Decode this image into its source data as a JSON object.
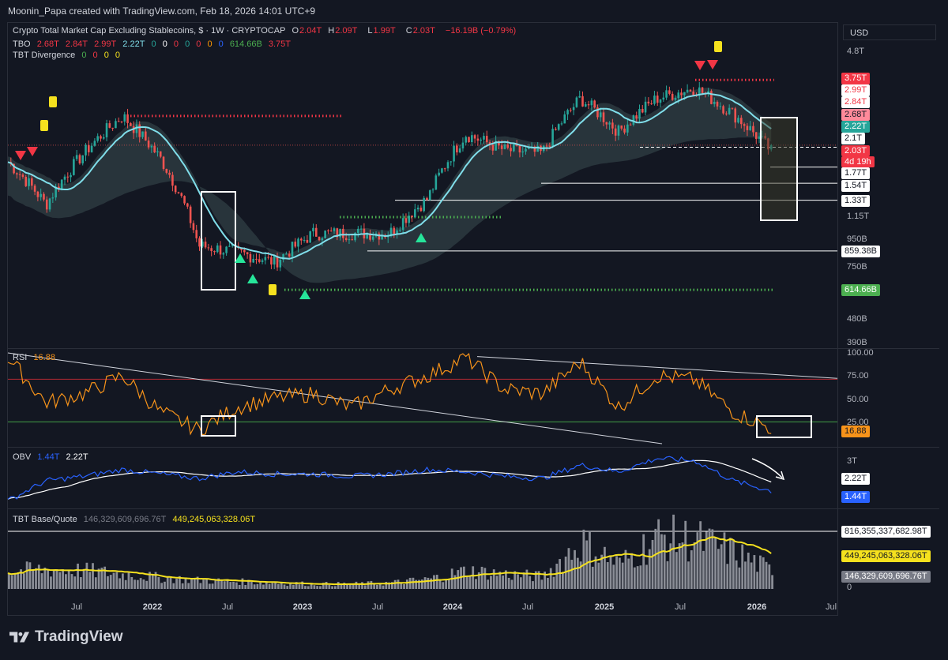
{
  "header": {
    "attribution": "Moonin_Papa created with TradingView.com, Feb 18, 2026 14:01 UTC+9"
  },
  "price_legend": {
    "symbol": "Crypto Total Market Cap Excluding Stablecoins, $ · 1W · CRYPTOCAP",
    "o_label": "O",
    "o": "2.04T",
    "h_label": "H",
    "h": "2.09T",
    "l_label": "L",
    "l": "1.99T",
    "c_label": "C",
    "c": "2.03T",
    "change": "−16.19B (−0.79%)"
  },
  "tbo_legend": {
    "name": "TBO",
    "values": [
      "2.68T",
      "2.84T",
      "2.99T",
      "2.22T",
      "0",
      "0",
      "0",
      "0",
      "0",
      "0",
      "0",
      "614.66B",
      "3.75T"
    ]
  },
  "divergence_legend": {
    "name": "TBT Divergence",
    "values": [
      "0",
      "0",
      "0",
      "0"
    ]
  },
  "rsi_legend": {
    "name": "RSI",
    "value": "16.88"
  },
  "obv_legend": {
    "name": "OBV",
    "v1": "1.44T",
    "v2": "2.22T"
  },
  "volume_legend": {
    "name": "TBT Base/Quote",
    "v1": "146,329,609,696.76T",
    "v2": "449,245,063,328.06T"
  },
  "currency": "USD",
  "price_axis_ticks": [
    "4.8T",
    "1.15T",
    "950B",
    "750B",
    "480B",
    "390B"
  ],
  "price_badges": [
    "3.75T",
    "2.99T",
    "2.84T",
    "2.68T",
    "2.22T",
    "2.1T",
    "2.03T",
    "4d 19h",
    "1.77T",
    "1.54T",
    "1.33T",
    "859.38B",
    "614.66B"
  ],
  "rsi_axis_ticks": [
    "100.00",
    "75.00",
    "50.00",
    "25.00"
  ],
  "rsi_badge": "16.88",
  "obv_axis_ticks": [
    "3T"
  ],
  "obv_badges": [
    "2.22T",
    "1.44T"
  ],
  "volume_badges": [
    "816,355,337,682.98T",
    "449,245,063,328.06T",
    "146,329,609,696.76T"
  ],
  "volume_axis_ticks": [
    "0"
  ],
  "time_axis": [
    "Jul",
    "2022",
    "Jul",
    "2023",
    "Jul",
    "2024",
    "Jul",
    "2025",
    "Jul",
    "2026",
    "Jul"
  ],
  "footer": {
    "brand": "TradingView"
  },
  "colors": {
    "background": "#131722",
    "up": "#26a69a",
    "down": "#ef5350",
    "ema": "#80deea",
    "ema_pink": "#f48fb1",
    "rsi": "#f7931a",
    "obv": "#2962ff",
    "volume_ma": "#f5e11e",
    "support_dots": "#4caf50",
    "resist_dots": "#f23645"
  },
  "chart_data": [
    {
      "type": "line",
      "title": "Crypto Total Market Cap Excluding Stablecoins, $ · 1W · CRYPTOCAP",
      "ylabel": "",
      "yscale": "log",
      "ylim": [
        390,
        4800
      ],
      "y_unit": "B",
      "x": [
        "2021-04",
        "2021-07",
        "2021-10",
        "2022-01",
        "2022-04",
        "2022-07",
        "2022-10",
        "2023-01",
        "2023-04",
        "2023-07",
        "2023-10",
        "2024-01",
        "2024-04",
        "2024-07",
        "2024-10",
        "2025-01",
        "2025-04",
        "2025-07",
        "2025-10",
        "2026-01",
        "2026-02"
      ],
      "series": [
        {
          "values": [
            1850,
            1280,
            2000,
            2750,
            1900,
            900,
            850,
            780,
            1000,
            1000,
            1000,
            1350,
            2350,
            2050,
            2000,
            3200,
            2400,
            3200,
            3500,
            2800,
            2030
          ]
        }
      ],
      "levels": {
        "resistance": 3750,
        "key": 2100,
        "supports": [
          1770,
          1540,
          1330,
          859.38,
          614.66
        ]
      }
    },
    {
      "type": "line",
      "title": "RSI",
      "ylim": [
        0,
        100
      ],
      "reference_lines": [
        75,
        25
      ],
      "x": [
        "2021-04",
        "2021-07",
        "2021-10",
        "2022-01",
        "2022-04",
        "2022-07",
        "2022-10",
        "2023-01",
        "2023-04",
        "2023-07",
        "2023-10",
        "2024-01",
        "2024-04",
        "2024-07",
        "2024-10",
        "2025-01",
        "2025-04",
        "2025-07",
        "2025-10",
        "2026-01",
        "2026-02"
      ],
      "series": [
        {
          "name": "RSI",
          "values": [
            95,
            45,
            55,
            75,
            35,
            15,
            40,
            50,
            55,
            40,
            60,
            75,
            95,
            60,
            55,
            90,
            40,
            75,
            70,
            35,
            16.88
          ]
        }
      ]
    },
    {
      "type": "line",
      "title": "OBV",
      "series": [
        {
          "name": "OBV",
          "values": [
            1.0,
            1.9,
            2.1,
            2.4,
            2.2,
            2.0,
            2.3,
            2.2,
            2.2,
            2.1,
            2.2,
            2.4,
            2.3,
            2.1,
            2.0,
            2.6,
            2.3,
            2.9,
            2.8,
            1.9,
            1.44
          ]
        }
      ]
    },
    {
      "type": "bar",
      "title": "TBT Base/Quote",
      "series": [
        {
          "name": "volume",
          "values": [
            146,
            160,
            150,
            120,
            90,
            70,
            60,
            50,
            40,
            40,
            50,
            80,
            150,
            120,
            100,
            380,
            200,
            420,
            400,
            300,
            146
          ]
        }
      ]
    }
  ]
}
